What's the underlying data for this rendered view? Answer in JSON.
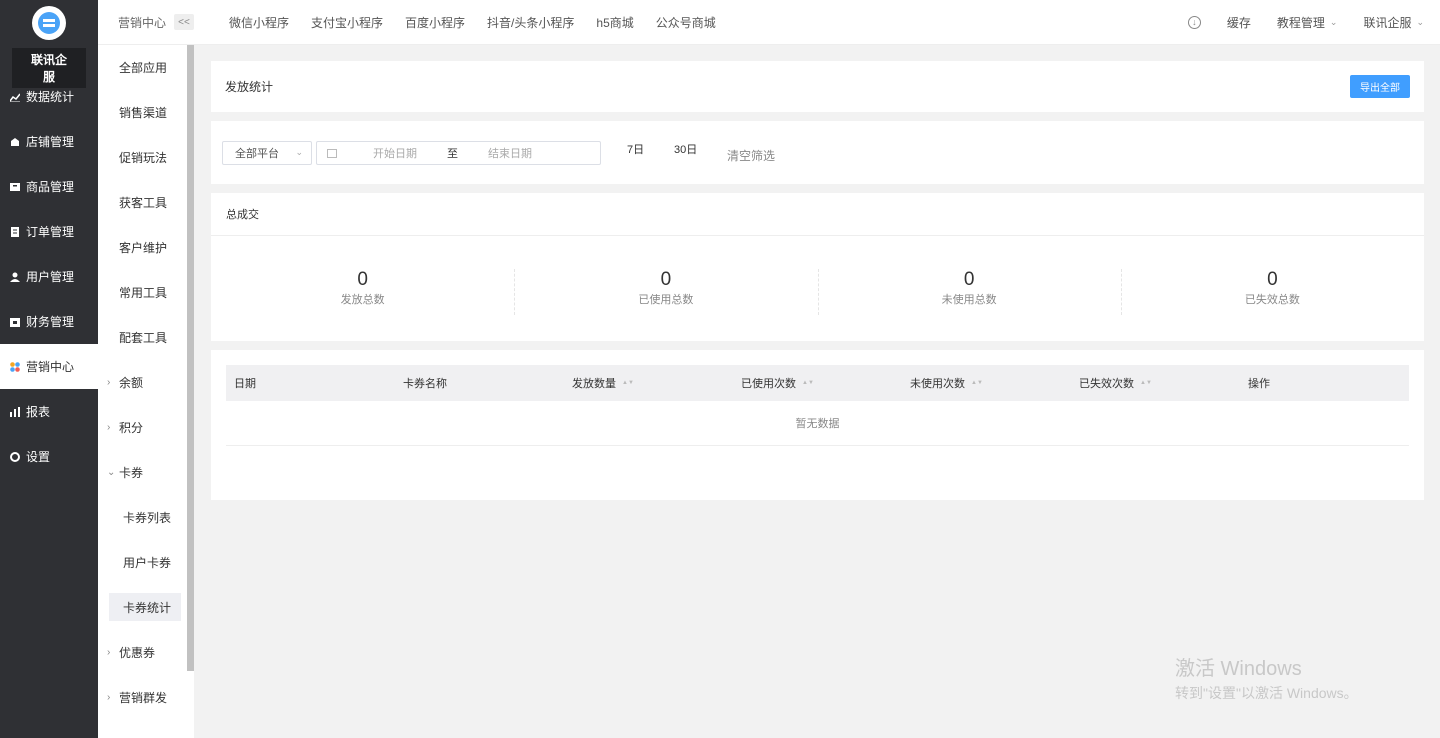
{
  "brand": "联讯企服",
  "main_menu": [
    {
      "label": "数据统计",
      "icon": "line-chart-icon"
    },
    {
      "label": "店铺管理",
      "icon": "store-icon"
    },
    {
      "label": "商品管理",
      "icon": "goods-icon"
    },
    {
      "label": "订单管理",
      "icon": "order-icon"
    },
    {
      "label": "用户管理",
      "icon": "user-icon"
    },
    {
      "label": "财务管理",
      "icon": "finance-icon"
    },
    {
      "label": "营销中心",
      "icon": "marketing-icon"
    },
    {
      "label": "报表",
      "icon": "report-icon"
    },
    {
      "label": "设置",
      "icon": "settings-icon"
    }
  ],
  "sub_menu": {
    "title": "营销中心",
    "collapse": "<<",
    "items": [
      "全部应用",
      "销售渠道",
      "促销玩法",
      "获客工具",
      "客户维护",
      "常用工具",
      "配套工具"
    ],
    "groups": {
      "balance": "余额",
      "points": "积分",
      "coupon": "卡券"
    },
    "coupon_children": [
      "卡券列表",
      "用户卡券",
      "卡券统计"
    ],
    "after": [
      "优惠券",
      "营销群发"
    ]
  },
  "top_tabs": [
    "微信小程序",
    "支付宝小程序",
    "百度小程序",
    "抖音/头条小程序",
    "h5商城",
    "公众号商城"
  ],
  "top_right": {
    "cache": "缓存",
    "tutorial": "教程管理",
    "account": "联讯企服"
  },
  "header_card": {
    "title": "发放统计",
    "export": "导出全部"
  },
  "filter": {
    "platform": "全部平台",
    "start_placeholder": "开始日期",
    "separator": "至",
    "end_placeholder": "结束日期",
    "q7": "7日",
    "q30": "30日",
    "clear": "清空筛选"
  },
  "summary": {
    "title": "总成交",
    "stats": [
      {
        "value": "0",
        "label": "发放总数"
      },
      {
        "value": "0",
        "label": "已使用总数"
      },
      {
        "value": "0",
        "label": "未使用总数"
      },
      {
        "value": "0",
        "label": "已失效总数"
      }
    ]
  },
  "table": {
    "columns": [
      "日期",
      "卡券名称",
      "发放数量",
      "已使用次数",
      "未使用次数",
      "已失效次数",
      "操作"
    ],
    "empty": "暂无数据"
  },
  "watermark": {
    "line1": "激活 Windows",
    "line2": "转到\"设置\"以激活 Windows。"
  }
}
